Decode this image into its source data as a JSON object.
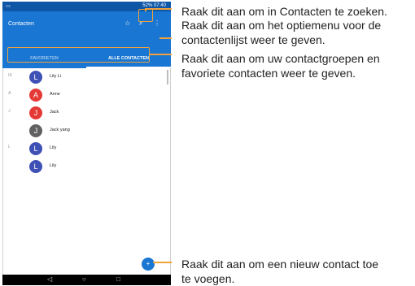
{
  "device": {
    "status_bar": {
      "left_icon": "notification-icon",
      "right_text": "52% 07:40"
    },
    "app_bar": {
      "title": "Contacten"
    },
    "tabs": [
      {
        "label": "FAVORIETEN"
      },
      {
        "label": "ALLE CONTACTEN"
      }
    ],
    "contacts": [
      {
        "index_letter": "IK",
        "initial": "L",
        "name": "Lily Li",
        "color": "#3f51b5"
      },
      {
        "index_letter": "A",
        "initial": "A",
        "name": "Anne",
        "color": "#e53935"
      },
      {
        "index_letter": "J",
        "initial": "J",
        "name": "Jack",
        "color": "#e53935"
      },
      {
        "index_letter": "",
        "initial": "J",
        "name": "Jack yang",
        "color": "#616161"
      },
      {
        "index_letter": "L",
        "initial": "L",
        "name": "Lily",
        "color": "#3f51b5"
      },
      {
        "index_letter": "",
        "initial": "L",
        "name": "Lily",
        "color": "#3f51b5"
      }
    ],
    "nav": {
      "back": "◁",
      "home": "○",
      "recent": "□"
    }
  },
  "annotations": {
    "search": "Raak dit aan om in Contacten te zoeken.",
    "menu_line1": "Raak dit aan om het optiemenu voor de",
    "menu_line2": "contactenlijst weer te geven.",
    "groups_line1": "Raak dit aan om uw contactgroepen en",
    "groups_line2": "favoriete contacten weer te geven.",
    "add_line1": "Raak dit aan om een nieuw contact toe",
    "add_line2": "te voegen."
  },
  "colors": {
    "primary": "#1976d2",
    "accent_frame": "#f2a23a"
  }
}
